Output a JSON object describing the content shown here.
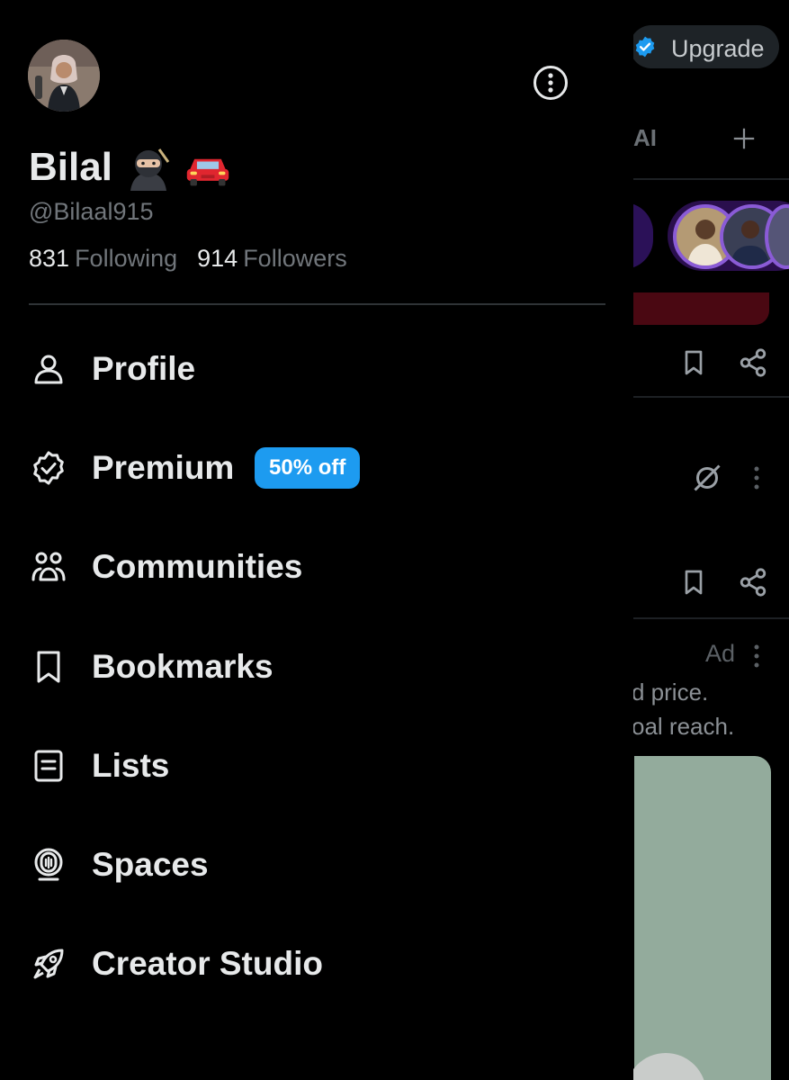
{
  "background": {
    "upgrade_label": "Upgrade",
    "tab_fragment": "AI",
    "ad_label": "Ad",
    "ad_lines": [
      "d price.",
      "oal reach."
    ],
    "icons": [
      "verified-icon",
      "plus-icon",
      "bookmark-icon",
      "share-icon",
      "grok-slash-icon",
      "more-vertical-icon"
    ]
  },
  "profile": {
    "display_name": "Bilal",
    "name_emojis": [
      "ninja-emoji",
      "red-car-emoji"
    ],
    "handle": "@Bilaal915",
    "following_count": "831",
    "following_label": "Following",
    "followers_count": "914",
    "followers_label": "Followers"
  },
  "menu": {
    "items": [
      {
        "label": "Profile",
        "icon": "person-icon"
      },
      {
        "label": "Premium",
        "icon": "verified-badge-icon",
        "badge": "50% off"
      },
      {
        "label": "Communities",
        "icon": "communities-icon"
      },
      {
        "label": "Bookmarks",
        "icon": "bookmark-icon"
      },
      {
        "label": "Lists",
        "icon": "lists-icon"
      },
      {
        "label": "Spaces",
        "icon": "spaces-icon"
      },
      {
        "label": "Creator Studio",
        "icon": "rocket-icon"
      }
    ]
  },
  "colors": {
    "background": "#000000",
    "text_primary": "#e7e9ea",
    "text_secondary": "#71767b",
    "accent": "#1d9bf0",
    "divider": "#2f3336"
  }
}
